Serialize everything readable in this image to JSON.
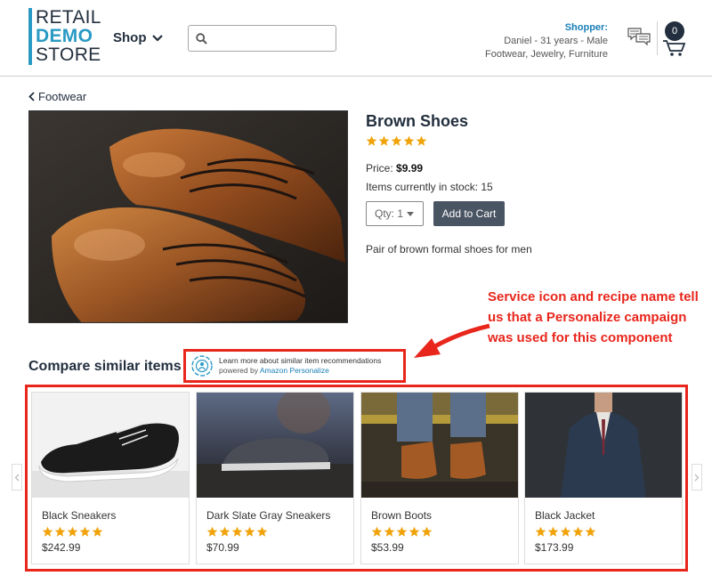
{
  "header": {
    "logo": {
      "line1": "RETAIL",
      "line2": "DEMO",
      "line3": "STORE"
    },
    "shop_menu_label": "Shop",
    "search": {
      "placeholder": "",
      "value": ""
    },
    "shopper": {
      "label": "Shopper:",
      "line1": "Daniel - 31 years - Male",
      "line2": "Footwear, Jewelry, Furniture"
    },
    "cart_count": "0"
  },
  "breadcrumb": {
    "label": "Footwear"
  },
  "product": {
    "title": "Brown Shoes",
    "rating": 5,
    "price_label": "Price:",
    "price_value": "$9.99",
    "stock_text": "Items currently in stock: 15",
    "qty_label": "Qty: 1",
    "add_to_cart_label": "Add to Cart",
    "description": "Pair of brown formal shoes for men"
  },
  "annotation": {
    "text": "Service icon and recipe name tell us that a Personalize campaign was used for this component"
  },
  "compare": {
    "title": "Compare similar items",
    "rec_line1": "Learn more about similar item recommendations",
    "rec_line2_prefix": "powered by",
    "rec_line2_link": "Amazon Personalize",
    "items": [
      {
        "name": "Black Sneakers",
        "price": "$242.99",
        "rating": 5
      },
      {
        "name": "Dark Slate Gray Sneakers",
        "price": "$70.99",
        "rating": 5
      },
      {
        "name": "Brown Boots",
        "price": "$53.99",
        "rating": 5
      },
      {
        "name": "Black Jacket",
        "price": "$173.99",
        "rating": 5
      }
    ]
  },
  "colors": {
    "brand_blue": "#2a9ac4",
    "navy": "#232f3e",
    "star": "#f0a30a",
    "annotation_red": "#e8261c",
    "button": "#4a5563"
  }
}
